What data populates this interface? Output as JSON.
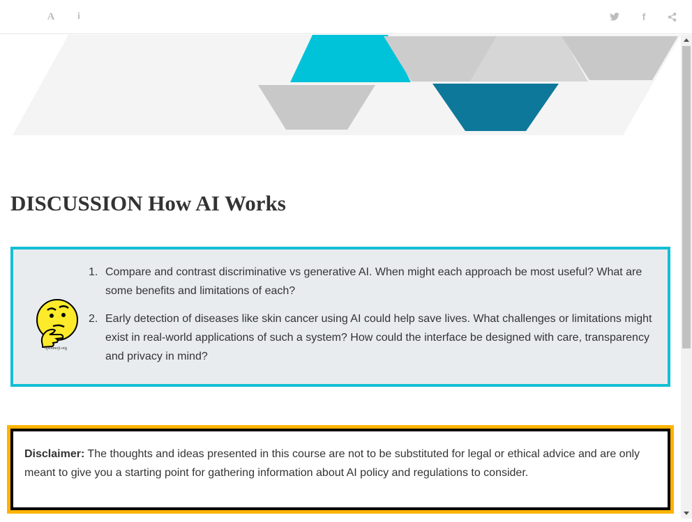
{
  "toolbar": {
    "font_icon": "A",
    "info_icon": "i",
    "facebook_icon": "f",
    "icons": [
      "font-settings-icon",
      "info-icon",
      "twitter-icon",
      "facebook-icon",
      "share-icon"
    ]
  },
  "banner": {
    "colors": {
      "cyan": "#00c3d9",
      "teal": "#0e789a",
      "gray": "#c8c8c8",
      "light": "#f4f4f4"
    }
  },
  "page": {
    "title": "DISCUSSION How AI Works"
  },
  "discussion": {
    "emoji_credit": "openmoji.org",
    "questions": [
      {
        "number": "1.",
        "text": "Compare and contrast discriminative vs generative AI. When might each approach be most useful? What are some benefits and limitations of each?"
      },
      {
        "number": "2.",
        "text": "Early detection of diseases like skin cancer using AI could help save lives. What challenges or limitations might exist in real-world applications of such a system? How could the interface be designed with care, transparency and privacy in mind?"
      }
    ],
    "colors": {
      "border": "#13bfd3",
      "background": "#e9ecef"
    }
  },
  "disclaimer": {
    "label": "Disclaimer:",
    "text": " The thoughts and ideas presented in this course are not to be substituted for legal or ethical advice and are only meant to give you a starting point for gathering information about AI policy and regulations to consider.",
    "colors": {
      "outer_border": "#ffb300",
      "inner_border": "#000000"
    }
  }
}
